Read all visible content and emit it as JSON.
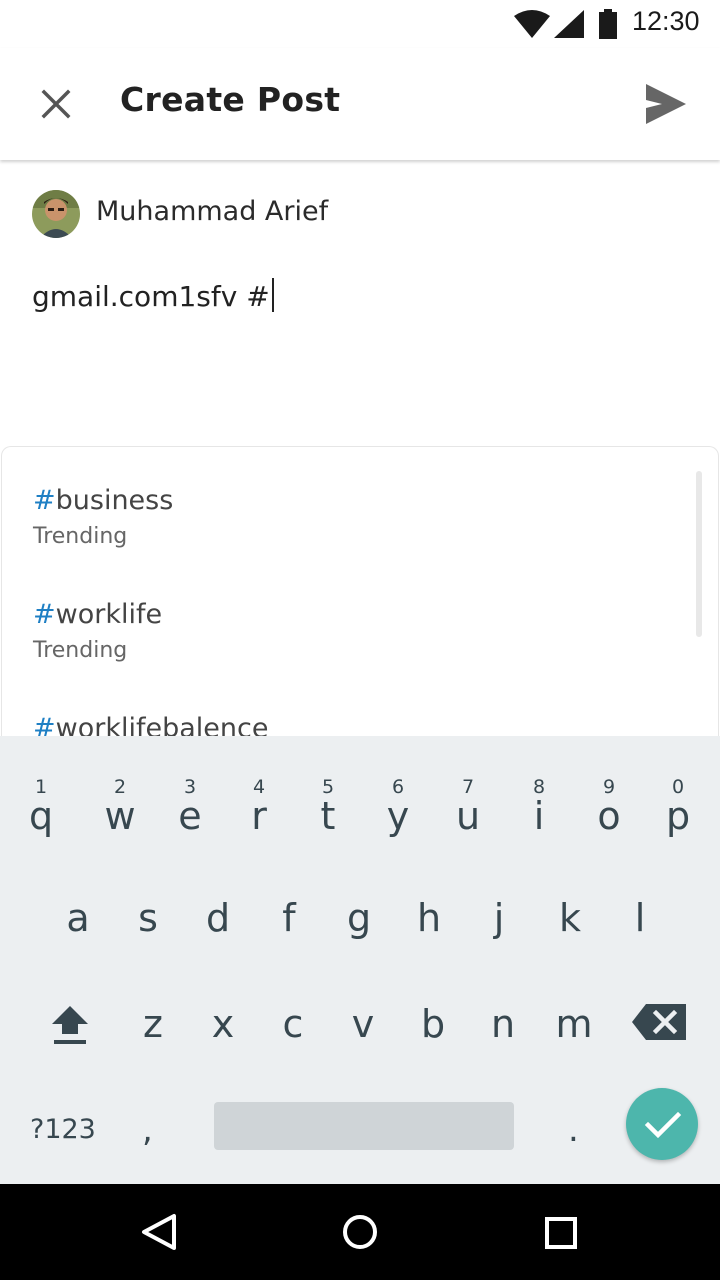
{
  "status_bar": {
    "time": "12:30",
    "icons": [
      "wifi-icon",
      "cellular-signal-icon",
      "battery-icon"
    ]
  },
  "app_bar": {
    "title": "Create Post",
    "close_icon": "close-icon",
    "send_icon": "send-icon"
  },
  "author": {
    "name": "Muhammad Arief",
    "avatar": "avatar-photo"
  },
  "post": {
    "text": "gmail.com1sfv #"
  },
  "suggestions": {
    "items": [
      {
        "hash": "#",
        "tag": "business",
        "subtitle": "Trending"
      },
      {
        "hash": "#",
        "tag": "worklife",
        "subtitle": "Trending"
      },
      {
        "hash": "#",
        "tag": "worklifebalence",
        "subtitle": ""
      }
    ],
    "hash_color": "#1e7fc4"
  },
  "keyboard": {
    "row1": [
      {
        "num": "1",
        "ch": "q"
      },
      {
        "num": "2",
        "ch": "w"
      },
      {
        "num": "3",
        "ch": "e"
      },
      {
        "num": "4",
        "ch": "r"
      },
      {
        "num": "5",
        "ch": "t"
      },
      {
        "num": "6",
        "ch": "y"
      },
      {
        "num": "7",
        "ch": "u"
      },
      {
        "num": "8",
        "ch": "i"
      },
      {
        "num": "9",
        "ch": "o"
      },
      {
        "num": "0",
        "ch": "p"
      }
    ],
    "row2": [
      "a",
      "s",
      "d",
      "f",
      "g",
      "h",
      "j",
      "k",
      "l"
    ],
    "row3": [
      "z",
      "x",
      "c",
      "v",
      "b",
      "n",
      "m"
    ],
    "symbols_label": "?123",
    "comma": ",",
    "period": ".",
    "enter_color": "#4db6ac"
  },
  "nav_bar": {
    "icons": [
      "back-icon",
      "home-icon",
      "recents-icon"
    ]
  }
}
